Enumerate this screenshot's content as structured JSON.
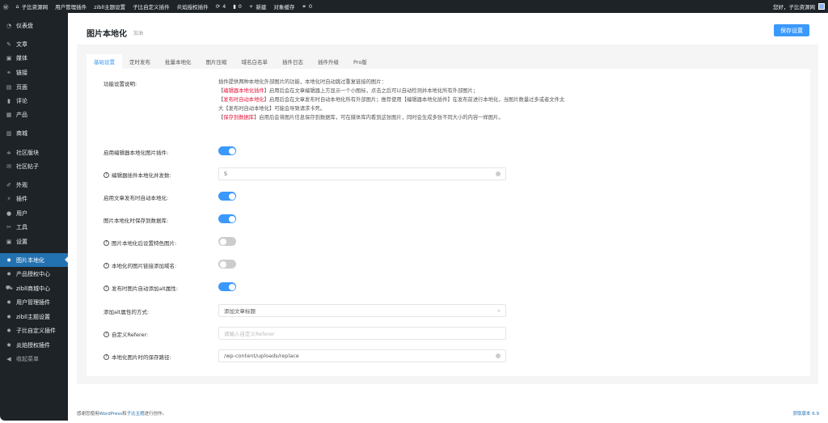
{
  "adminbar": {
    "site": "子比资源网",
    "items": [
      "用户管理插件",
      "zibll主题设置",
      "子比自定义插件",
      "炎焰授权插件"
    ],
    "updates": "4",
    "comments": "0",
    "new": "新建",
    "cache": "对象缓存",
    "links": "0",
    "greeting": "您好，子比资源网"
  },
  "sidebar": {
    "items": [
      {
        "label": "仪表盘",
        "icon": "dashboard-icon"
      },
      {
        "label": "文章",
        "icon": "pin-icon"
      },
      {
        "label": "媒体",
        "icon": "media-icon"
      },
      {
        "label": "链接",
        "icon": "link-icon"
      },
      {
        "label": "页面",
        "icon": "page-icon"
      },
      {
        "label": "评论",
        "icon": "comment-icon"
      },
      {
        "label": "产品",
        "icon": "box-icon"
      },
      {
        "label": "商城",
        "icon": "shop-icon"
      },
      {
        "label": "社区版块",
        "icon": "forum-icon"
      },
      {
        "label": "社区帖子",
        "icon": "post-icon"
      },
      {
        "label": "外观",
        "icon": "brush-icon"
      },
      {
        "label": "插件",
        "icon": "plugin-icon"
      },
      {
        "label": "用户",
        "icon": "user-icon"
      },
      {
        "label": "工具",
        "icon": "wrench-icon"
      },
      {
        "label": "设置",
        "icon": "settings-icon"
      },
      {
        "label": "图片本地化",
        "icon": "gear-icon"
      },
      {
        "label": "产品授权中心",
        "icon": "gear-icon"
      },
      {
        "label": "zibll商城中心",
        "icon": "cart-icon"
      },
      {
        "label": "用户管理插件",
        "icon": "gear-icon"
      },
      {
        "label": "zibll主题设置",
        "icon": "gear-icon"
      },
      {
        "label": "子比自定义插件",
        "icon": "gear-icon"
      },
      {
        "label": "炎焰授权插件",
        "icon": "gear-icon"
      },
      {
        "label": "收起菜单",
        "icon": "collapse-icon"
      }
    ],
    "active": "图片本地化"
  },
  "page": {
    "title": "图片本地化",
    "subtitle": "加油",
    "save": "保存设置"
  },
  "tabs": [
    "基础设置",
    "定时发布",
    "批量本地化",
    "图片压缩",
    "域名白名单",
    "插件日志",
    "插件升级",
    "Pro版"
  ],
  "desc": {
    "label": "功能设置说明:",
    "line1": "插件提供两种本地化外部图片的功能，本地化时自动跳过重复链接的图片：",
    "l2a": "编辑器本地化插件",
    "l2b": "】启用后会在文章编辑器上方显示一个小图标，点击之后可以自动检测并本地化所有外部图片；",
    "l3a": "发布时自动本地化",
    "l3b": "】启用后会在文章发布时自动本地化所有外部图片；推荐使用【编辑器本地化插件】在发布前进行本地化，当图片数量过多或者文件太大【发布时自动本地化】可能会导致请求卡死。",
    "l4a": "保存到数据库",
    "l4b": "】启用后会将图片信息保存到数据库，可在媒体库内看到这张图片，同时会生成多张不同大小的内容一样图片。",
    "bracket": "【"
  },
  "fields": [
    {
      "label": "启用编辑器本地化图片插件:",
      "type": "toggle",
      "on": true
    },
    {
      "label": "编辑器插件本地化并发数:",
      "help": true,
      "type": "input",
      "value": "5"
    },
    {
      "label": "启用文章发布时自动本地化:",
      "type": "toggle",
      "on": true
    },
    {
      "label": "图片本地化时保存到数据库:",
      "type": "toggle",
      "on": true
    },
    {
      "label": "图片本地化后设置特色图片:",
      "help": true,
      "type": "toggle",
      "on": false
    },
    {
      "label": "本地化的图片链接添加域名:",
      "help": true,
      "type": "toggle",
      "on": false
    },
    {
      "label": "发布时图片自动添加alt属性:",
      "help": true,
      "type": "toggle",
      "on": true
    },
    {
      "label": "添加alt属性的方式:",
      "type": "select",
      "value": "添加文章标题"
    },
    {
      "label": "自定义Referer:",
      "help": true,
      "type": "input",
      "placeholder": "请输入自定义Referer"
    },
    {
      "label": "本地化图片时的保存路径:",
      "help": true,
      "type": "input",
      "value": "/wp-content/uploads/replace"
    }
  ],
  "footer": {
    "pre": "感谢您使用",
    "wp": "WordPress",
    "and": "和",
    "theme": "子比主题",
    "post": "进行创作。",
    "version": "获取版本 6.9"
  }
}
